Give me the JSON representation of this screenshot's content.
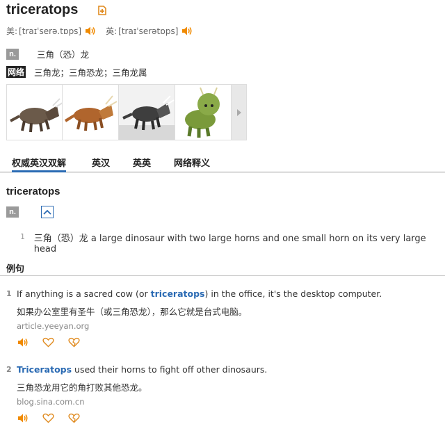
{
  "word": "triceratops",
  "phonetics": {
    "us": {
      "label": "美:",
      "ipa": "[traɪˈserə.tɒps]"
    },
    "uk": {
      "label": "英:",
      "ipa": "[traɪˈserətɒps]"
    }
  },
  "definitions": {
    "pos_tag": "n.",
    "pos_meaning": "三角（恐）龙",
    "net_tag": "网络",
    "net_meaning": "三角龙；三角恐龙；三角龙属"
  },
  "images": [
    {
      "alt": "triceratops-thumb-1"
    },
    {
      "alt": "triceratops-thumb-2"
    },
    {
      "alt": "triceratops-thumb-3"
    },
    {
      "alt": "triceratops-thumb-4"
    }
  ],
  "tabs": [
    {
      "label": "权威英汉双解",
      "active": true
    },
    {
      "label": "英汉"
    },
    {
      "label": "英英"
    },
    {
      "label": "网络释义"
    }
  ],
  "section": {
    "word": "triceratops",
    "pos_tag": "n.",
    "senses": [
      {
        "num": "1",
        "text": "三角（恐）龙 a large dinosaur with two large horns and one small horn on its very large head"
      }
    ]
  },
  "examples": {
    "heading": "例句",
    "items": [
      {
        "num": "1",
        "en_before": "If anything is a sacred cow (or ",
        "en_highlight": "triceratops",
        "en_after": ") in the office, it's the desktop computer.",
        "cn": "如果办公室里有圣牛（或三角恐龙），那么它就是台式电脑。",
        "source": "article.yeeyan.org"
      },
      {
        "num": "2",
        "en_before": "",
        "en_highlight": "Triceratops",
        "en_after": " used their horns to fight off other dinosaurs.",
        "cn": "三角恐龙用它的角打败其他恐龙。",
        "source": "blog.sina.com.cn"
      }
    ]
  },
  "colors": {
    "accent": "#2a6ab3",
    "speaker": "#f08a00",
    "icon_orange": "#e08a1e"
  }
}
